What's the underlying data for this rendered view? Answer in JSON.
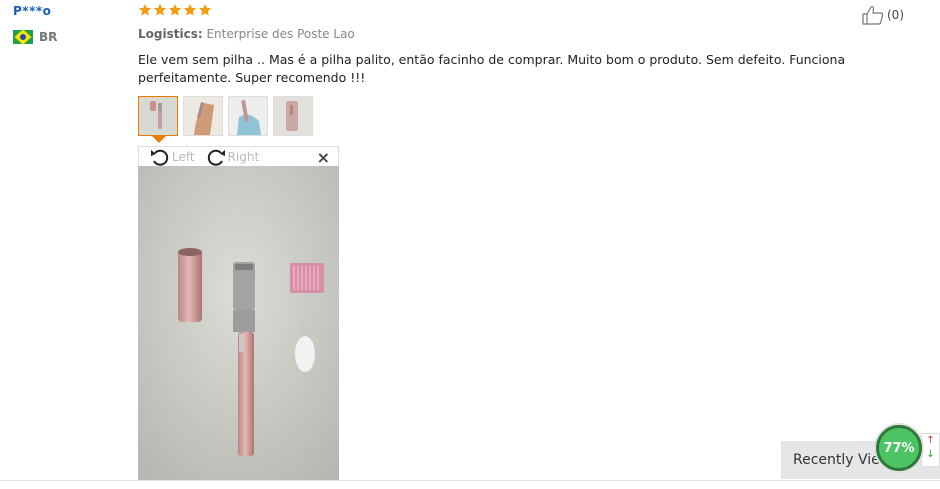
{
  "review": {
    "username": "P***o",
    "country_code": "BR",
    "rating": 5,
    "logistics_label": "Logistics:",
    "logistics_value": "Enterprise des Poste Lao",
    "text": "Ele vem sem pilha .. Mas é a pilha palito, então facinho de comprar. Muito bom o produto. Sem defeito. Funciona perfeitamente. Super recomendo !!!",
    "helpful_count": "(0)",
    "thumbnails": [
      "thumb-1",
      "thumb-2",
      "thumb-3",
      "thumb-4"
    ]
  },
  "viewer": {
    "rotate_left_label": "Left",
    "rotate_right_label": "Right",
    "close_label": "×"
  },
  "widgets": {
    "recently_viewed_label": "Recently Viewed",
    "progress_label": "77%",
    "progress_value": 0.77
  },
  "colors": {
    "username": "#1a5fb4",
    "star": "#f39c12",
    "active_thumb_border": "#e87d00",
    "badge": "#4cc464"
  }
}
